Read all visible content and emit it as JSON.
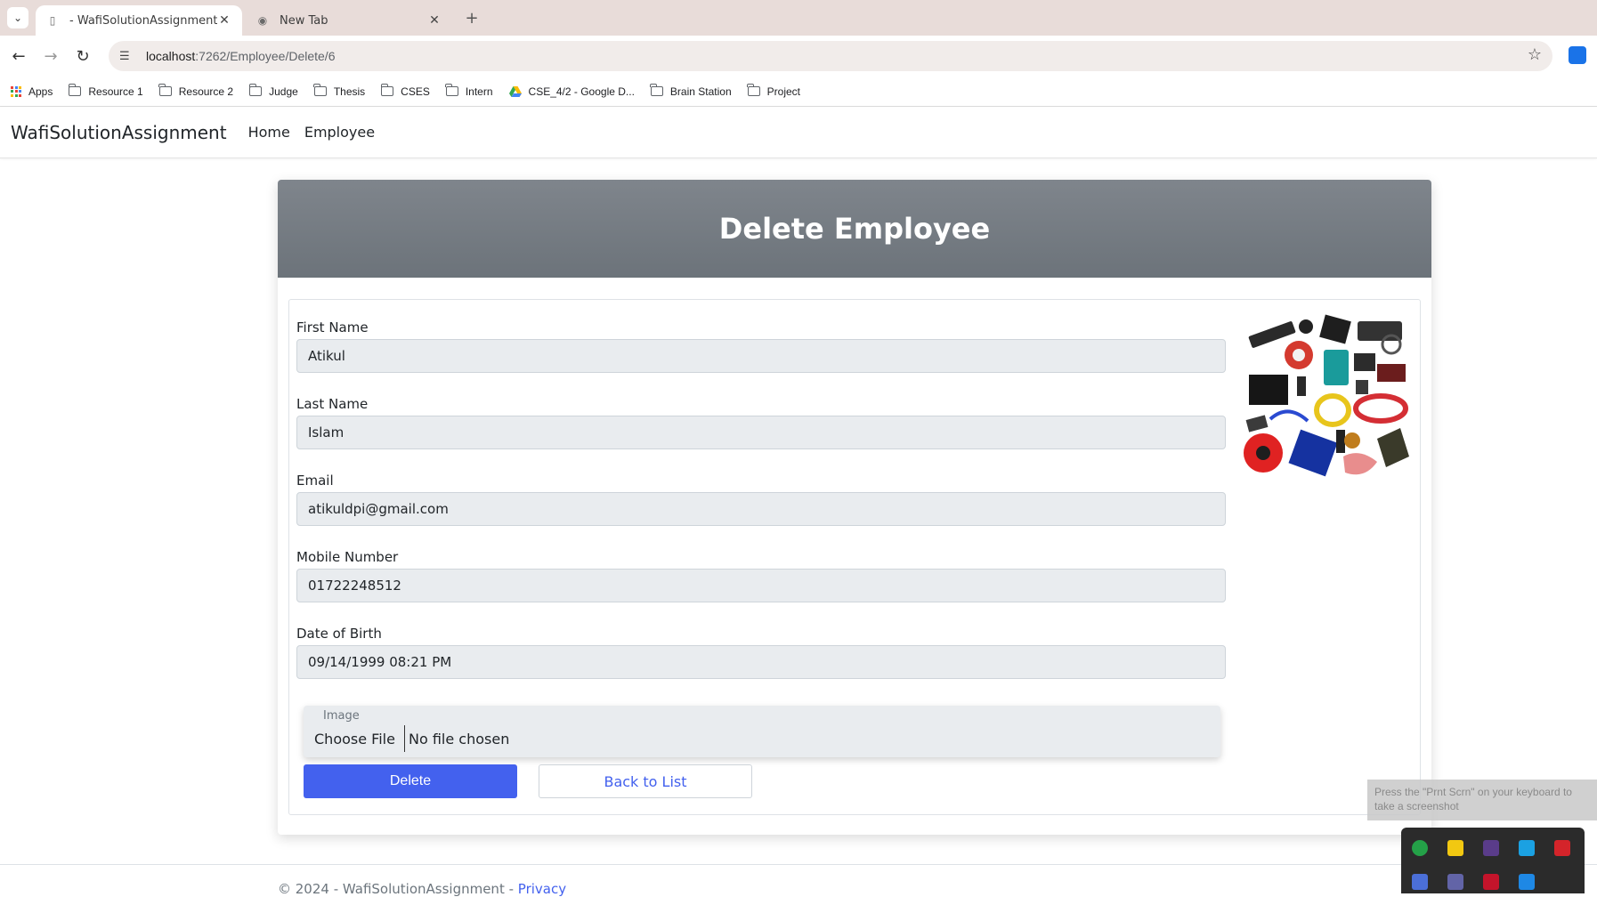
{
  "browser": {
    "tabs": [
      {
        "title": "- WafiSolutionAssignment",
        "active": true
      },
      {
        "title": "New Tab",
        "active": false
      }
    ],
    "url_host": "localhost",
    "url_path": ":7262/Employee/Delete/6",
    "bookmarks": [
      "Apps",
      "Resource 1",
      "Resource 2",
      "Judge",
      "Thesis",
      "CSES",
      "Intern",
      "CSE_4/2 - Google D...",
      "Brain Station",
      "Project"
    ]
  },
  "nav": {
    "brand": "WafiSolutionAssignment",
    "links": [
      "Home",
      "Employee"
    ]
  },
  "page": {
    "title": "Delete Employee",
    "fields": [
      {
        "label": "First Name",
        "value": "Atikul"
      },
      {
        "label": "Last Name",
        "value": "Islam"
      },
      {
        "label": "Email",
        "value": "atikuldpi@gmail.com"
      },
      {
        "label": "Mobile Number",
        "value": "01722248512"
      },
      {
        "label": "Date of Birth",
        "value": "09/14/1999 08:21  PM"
      }
    ],
    "image_label": "Image",
    "choose_file": "Choose File",
    "file_status": "No file chosen",
    "delete_label": "Delete",
    "back_label": "Back to List"
  },
  "footer": {
    "text": "© 2024 - WafiSolutionAssignment - ",
    "privacy": "Privacy"
  },
  "toast": "Press the \"Prnt Scrn\" on your keyboard to take a screenshot",
  "colors": {
    "primary": "#4361ee",
    "header": "#747b82"
  }
}
